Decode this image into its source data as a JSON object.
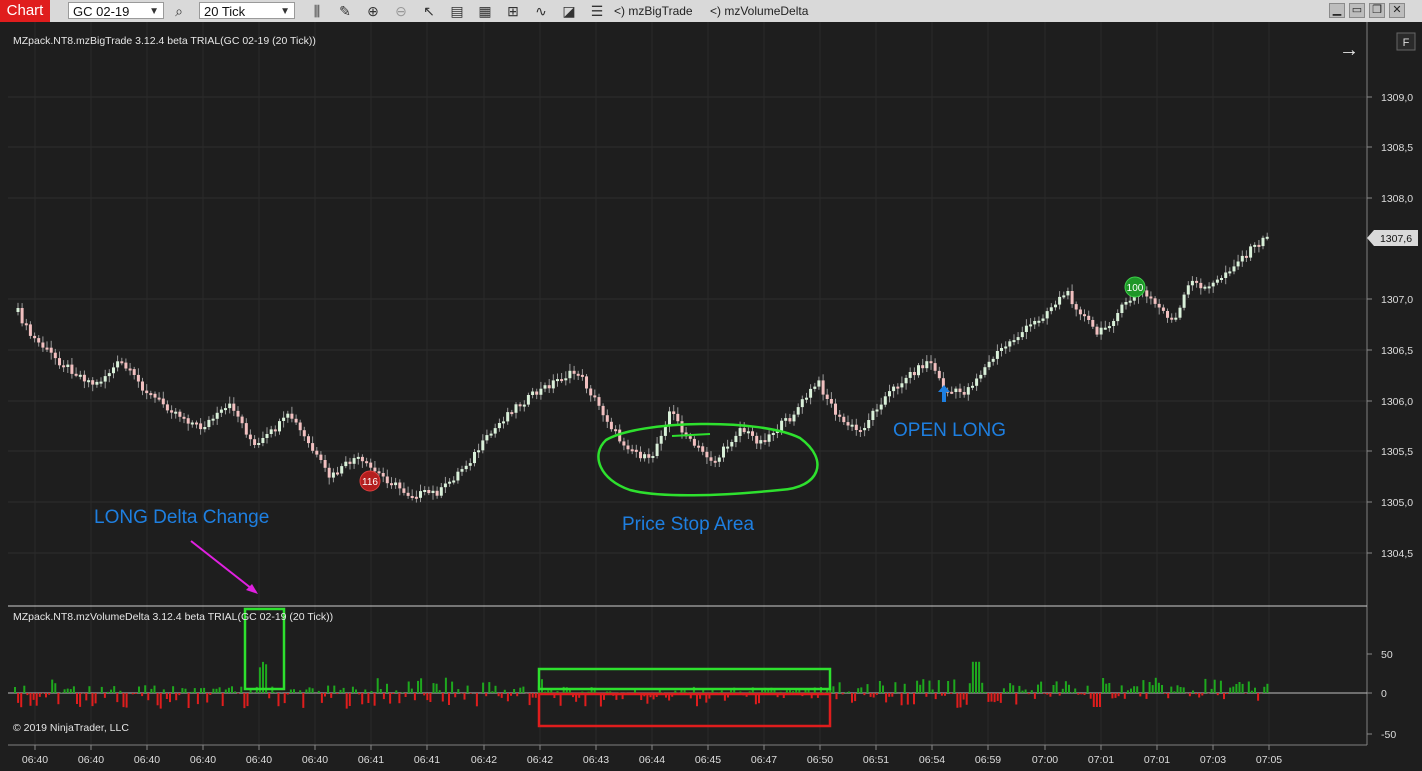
{
  "toolbar": {
    "chart_label": "Chart",
    "instrument": "GC 02-19",
    "interval": "20 Tick",
    "indicator_1": "mzBigTrade",
    "indicator_2": "mzVolumeDelta",
    "icons": [
      "search-icon",
      "bar-style-icon",
      "draw-icon",
      "zoom-in-icon",
      "zoom-out-icon",
      "select-icon",
      "properties-icon",
      "templates-icon",
      "strategies-icon",
      "indicators-icon",
      "chart-trader-icon",
      "data-box-icon"
    ],
    "window_buttons": [
      "minimize",
      "maximize",
      "restore",
      "close"
    ]
  },
  "price_panel": {
    "title": "MZpack.NT8.mzBigTrade 3.12.4 beta TRIAL(GC 02-19 (20 Tick))",
    "y_ticks": [
      "1309,0",
      "1308,5",
      "1308,0",
      "1307,0",
      "1306,5",
      "1306,0",
      "1305,5",
      "1305,0",
      "1304,5"
    ],
    "current_price": "1307,6",
    "markers": [
      {
        "label": "116",
        "color": "#b41e1e"
      },
      {
        "label": "100",
        "color": "#1e9628"
      }
    ],
    "annotations": {
      "open_long": "OPEN LONG",
      "price_stop": "Price Stop Area"
    },
    "f_label": "F"
  },
  "delta_panel": {
    "title": "MZpack.NT8.mzVolumeDelta 3.12.4 beta TRIAL(GC 02-19 (20 Tick))",
    "y_ticks": [
      "50",
      "0",
      "-50"
    ],
    "annotation": "LONG Delta Change",
    "copyright": "© 2019 NinjaTrader, LLC"
  },
  "x_axis": {
    "ticks": [
      "06:40",
      "06:40",
      "06:40",
      "06:40",
      "06:40",
      "06:40",
      "06:41",
      "06:41",
      "06:42",
      "06:42",
      "06:43",
      "06:44",
      "06:45",
      "06:47",
      "06:50",
      "06:51",
      "06:54",
      "06:59",
      "07:00",
      "07:01",
      "07:01",
      "07:03",
      "07:05"
    ]
  },
  "colors": {
    "up": "#1ea81e",
    "down": "#e01d1d",
    "accent": "#1e7fe0",
    "highlight": "#2ee02e"
  }
}
